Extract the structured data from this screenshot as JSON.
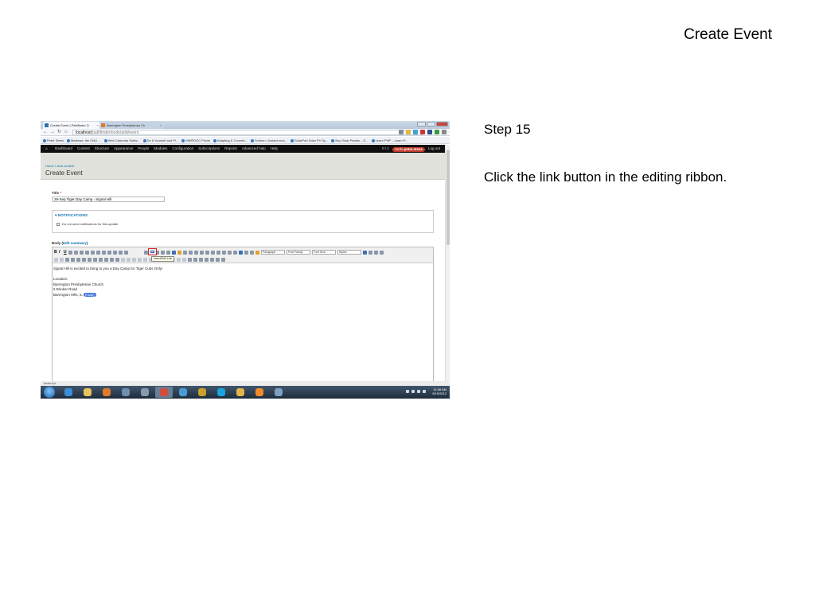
{
  "slide": {
    "title": "Create Event",
    "step_title": "Step 15",
    "instruction": "Click the link button in the editing ribbon."
  },
  "browser": {
    "tabs": [
      {
        "label": "Create Event | Pathfinder D",
        "active": true
      },
      {
        "label": "Barrington Presbyterian Ch",
        "active": false
      }
    ],
    "url_host": "localhost",
    "url_path": "/pathfinder/node/add/event",
    "bookmarks": [
      "Peter Stees",
      "Mathnas: the GNU ...",
      "Web Calendar Softw...",
      "Do It Yourself and Pl...",
      "MWRDGC Portal",
      "Adapting & Convert...",
      "Scrieon | Instant scra...",
      "SolarPod Solar PV Sy...",
      "Buy Solar Panels – E...",
      "Learn PHP – Learn P..."
    ]
  },
  "admin_menu": {
    "items": [
      "Dashboard",
      "Content",
      "Structure",
      "Appearance",
      "People",
      "Modules",
      "Configuration",
      "Subscriptions",
      "Reports",
      "Advanced help",
      "Help"
    ],
    "counter": "0 / 1",
    "hello_prefix": "Hello",
    "username": "peter.stees",
    "logout": "Log out"
  },
  "page": {
    "breadcrumb": "Home » Add content",
    "title": "Create Event"
  },
  "form": {
    "title_label": "Title",
    "required_mark": "*",
    "title_value": "29-Sep Tiger Day Camp - Signal Hill",
    "notifications_legend": "▾ NOTIFICATIONS",
    "notifications_checkbox": "Do not send notifications for this update.",
    "body_label": "Body (",
    "body_edit_summary": "Edit summary",
    "body_label_end": ")"
  },
  "editor": {
    "format_select": "Paragraph",
    "font_family_select": "Font Family",
    "font_size_select": "Font Size",
    "styles_select": "Styles",
    "link_tooltip": "Insert/Edit Link",
    "lines": [
      "Signal Hill is excited to bring to you a Day Camp for Tiger Cubs Only!",
      "",
      "Location:",
      "Barrington Presbyterian Church",
      "6 Brinker Road"
    ],
    "last_line_prefix": "Barrington Hills, IL",
    "selected_word": "(map)"
  },
  "status": {
    "left": "Javascript:"
  },
  "taskbar": {
    "time": "11:58 AM",
    "date": "9/19/2012"
  },
  "colors": {
    "admin_bar": "#0f0f0f",
    "hello_badge": "#c0392b",
    "link_highlight": "#e0231b",
    "selection": "#3b6fd8",
    "drupal_link": "#0071b3"
  }
}
